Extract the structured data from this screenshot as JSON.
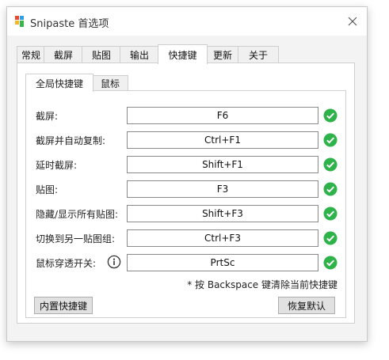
{
  "window": {
    "title": "Snipaste 首选项"
  },
  "tabs": [
    {
      "label": "常规"
    },
    {
      "label": "截屏"
    },
    {
      "label": "贴图"
    },
    {
      "label": "输出"
    },
    {
      "label": "快捷键",
      "active": true
    },
    {
      "label": "更新"
    },
    {
      "label": "关于"
    }
  ],
  "subtabs": [
    {
      "label": "全局快捷键",
      "active": true
    },
    {
      "label": "鼠标"
    }
  ],
  "hotkeys": [
    {
      "label": "截屏:",
      "value": "F6",
      "status": "ok"
    },
    {
      "label": "截屏并自动复制:",
      "value": "Ctrl+F1",
      "status": "ok"
    },
    {
      "label": "延时截屏:",
      "value": "Shift+F1",
      "status": "ok"
    },
    {
      "label": "贴图:",
      "value": "F3",
      "status": "ok"
    },
    {
      "label": "隐藏/显示所有贴图:",
      "value": "Shift+F3",
      "status": "ok"
    },
    {
      "label": "切换到另一贴图组:",
      "value": "Ctrl+F3",
      "status": "ok"
    },
    {
      "label": "鼠标穿透开关:",
      "value": "PrtSc",
      "status": "ok",
      "info_icon": "info-icon"
    }
  ],
  "hint": "* 按 Backspace 键清除当前快捷键",
  "buttons": {
    "builtin_label": "内置快捷键",
    "restore_label": "恢复默认"
  },
  "icons": {
    "close": "close-icon",
    "check": "check-circle-icon",
    "logo": "snipaste-logo-icon"
  },
  "colors": {
    "check_green": "#2eb24a",
    "accent": "#2c2c2c"
  }
}
